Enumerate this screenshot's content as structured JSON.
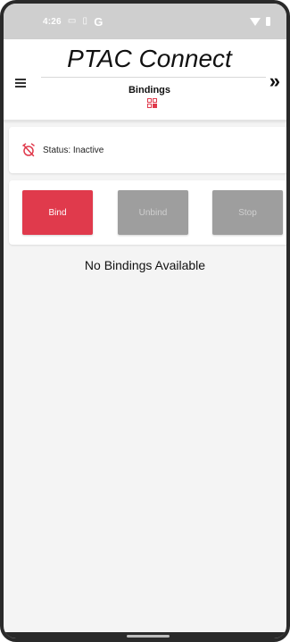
{
  "status_bar": {
    "time": "4:26",
    "icons": [
      "message-icon",
      "sim-card-icon",
      "google-icon",
      "wifi-icon",
      "battery-icon"
    ],
    "g_label": "G"
  },
  "header": {
    "app_title": "PTAC Connect",
    "page_label": "Bindings",
    "menu_icon": "hamburger-menu-icon",
    "forward_icon": "double-chevron-right-icon",
    "forward_glyph": "»",
    "page_icon": "grid-qr-icon"
  },
  "status_card": {
    "icon": "alarm-off-icon",
    "text": "Status: Inactive"
  },
  "actions": {
    "bind_label": "Bind",
    "unbind_label": "Unbind",
    "stop_label": "Stop"
  },
  "empty_state": {
    "message": "No Bindings Available"
  },
  "colors": {
    "accent": "#e03a4c",
    "disabled_button": "#9e9e9e",
    "status_bar": "#cfcfcf"
  }
}
